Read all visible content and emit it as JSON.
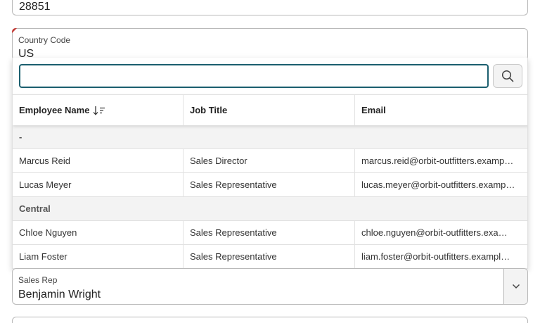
{
  "zip_field": {
    "value": "28851"
  },
  "country_field": {
    "label": "Country Code",
    "value": "US"
  },
  "lookup": {
    "search": {
      "value": "",
      "placeholder": ""
    },
    "columns": [
      "Employee Name",
      "Job Title",
      "Email"
    ],
    "groups": [
      {
        "name": "-",
        "rows": [
          {
            "name": "Marcus Reid",
            "title": "Sales Director",
            "email": "marcus.reid@orbit-outfitters.examp…"
          },
          {
            "name": "Lucas Meyer",
            "title": "Sales Representative",
            "email": "lucas.meyer@orbit-outfitters.examp…"
          }
        ]
      },
      {
        "name": "Central",
        "rows": [
          {
            "name": "Chloe Nguyen",
            "title": "Sales Representative",
            "email": "chloe.nguyen@orbit-outfitters.exa…"
          },
          {
            "name": "Liam Foster",
            "title": "Sales Representative",
            "email": "liam.foster@orbit-outfitters.exampl…"
          }
        ]
      }
    ]
  },
  "sales_rep_field": {
    "label": "Sales Rep",
    "value": "Benjamin Wright"
  },
  "colors": {
    "focus_border": "#1b5f6f",
    "required_marker": "#c23934",
    "group_bg": "#f3f3f3"
  },
  "icons": {
    "search": "search-icon",
    "sort": "sort-descending-icon",
    "dropdown": "chevron-down-icon"
  }
}
